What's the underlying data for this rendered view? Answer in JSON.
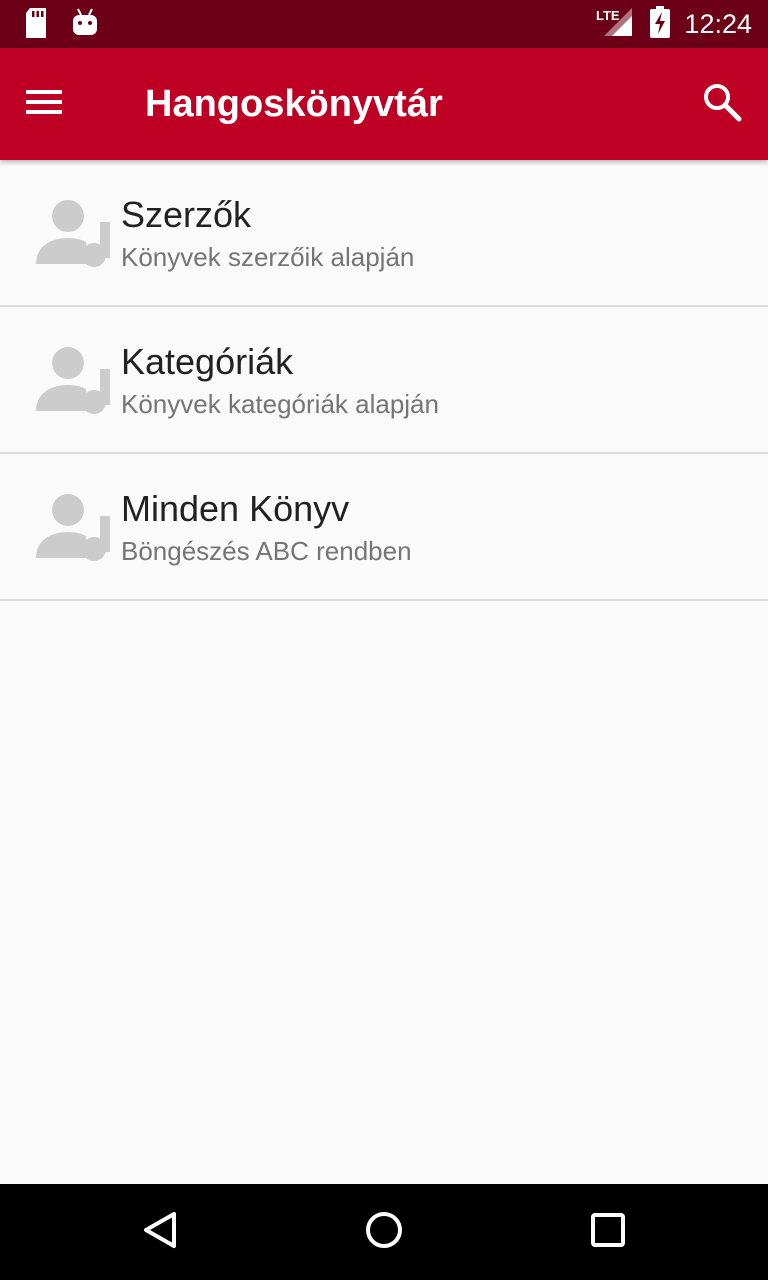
{
  "status_bar": {
    "time": "12:24",
    "network_label": "LTE",
    "icons": [
      "sd-card-icon",
      "android-icon",
      "lte-signal-icon",
      "battery-charging-icon"
    ]
  },
  "app_bar": {
    "title": "Hangoskönyvtár",
    "menu_icon": "hamburger-menu-icon",
    "search_icon": "search-icon"
  },
  "list": {
    "items": [
      {
        "title": "Szerzők",
        "subtitle": "Könyvek szerzőik alapján",
        "icon": "person-music-icon"
      },
      {
        "title": "Kategóriák",
        "subtitle": "Könyvek kategóriák alapján",
        "icon": "person-music-icon"
      },
      {
        "title": "Minden Könyv",
        "subtitle": "Böngészés ABC rendben",
        "icon": "person-music-icon"
      }
    ]
  },
  "nav_bar": {
    "buttons": [
      "back-icon",
      "home-icon",
      "recents-icon"
    ]
  },
  "colors": {
    "status_bar": "#6b0016",
    "app_bar": "#bd0024",
    "background": "#fafafa",
    "title_text": "#212121",
    "subtitle_text": "#757575",
    "icon_gray": "#cccccc",
    "divider": "#dcdcdc"
  }
}
